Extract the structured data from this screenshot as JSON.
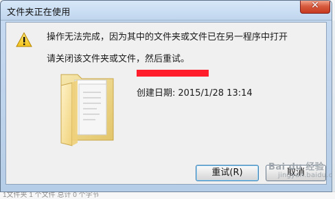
{
  "window": {
    "title": "文件夹正在使用",
    "close_glyph": "✕"
  },
  "dialog": {
    "message_primary": "操作无法完成，因为其中的文件夹或文件已在另一程序中打开",
    "message_secondary": "请关闭该文件夹或文件，然后重试。",
    "created_label": "创建日期:",
    "created_value": "2015/1/28 13:14",
    "redaction_color": "#ff1d2b",
    "icons": {
      "warning": "warning-icon",
      "folder": "folder-icon"
    }
  },
  "buttons": {
    "retry": "重试(R)",
    "cancel": "取消"
  },
  "watermark": {
    "line1": "Bai du 经验",
    "line2": "jingyan.baidu.com"
  },
  "background": {
    "bottom_text": "1文件夹 1 个文件 总计 0 个字节"
  }
}
